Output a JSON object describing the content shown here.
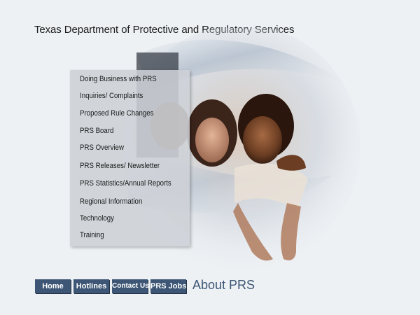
{
  "header": {
    "title": "Texas Department of Protective and Regulatory Services"
  },
  "menu": {
    "items": [
      {
        "label": "Doing Business with PRS"
      },
      {
        "label": "Inquiries/ Complaints"
      },
      {
        "label": "Proposed Rule Changes"
      },
      {
        "label": "PRS Board"
      },
      {
        "label": "PRS Overview"
      },
      {
        "label": "PRS Releases/ Newsletter"
      },
      {
        "label": "PRS Statistics/Annual Reports"
      },
      {
        "label": "Regional Information"
      },
      {
        "label": "Technology"
      },
      {
        "label": "Training"
      }
    ]
  },
  "nav": {
    "buttons": [
      {
        "label": "Home"
      },
      {
        "label": "Hotlines"
      },
      {
        "label": "Contact Us"
      },
      {
        "label": "PRS Jobs"
      }
    ]
  },
  "section": {
    "title": "About PRS"
  },
  "colors": {
    "nav_button": "#3d5675",
    "section_title": "#3d5675",
    "background": "#eef1f4"
  }
}
